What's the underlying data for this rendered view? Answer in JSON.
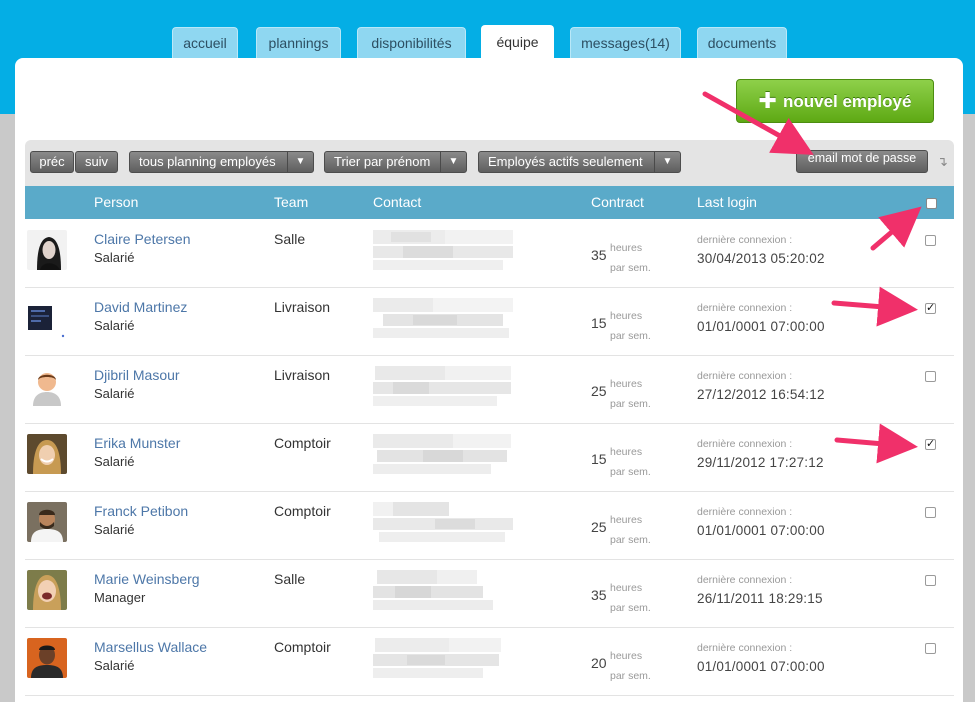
{
  "tabs": [
    {
      "label": "accueil",
      "active": false
    },
    {
      "label": "plannings",
      "active": false
    },
    {
      "label": "disponibilités",
      "active": false
    },
    {
      "label": "équipe",
      "active": true
    },
    {
      "label": "messages(14)",
      "active": false
    },
    {
      "label": "documents",
      "active": false
    }
  ],
  "new_employee_button": {
    "label": "nouvel employé",
    "icon": "plus-icon"
  },
  "toolbar": {
    "prev_label": "préc",
    "next_label": "suiv",
    "planning_select": "tous planning employés",
    "sort_select": "Trier par prénom",
    "filter_select": "Employés actifs seulement",
    "email_password_label": "email mot de passe",
    "sort_icon": "down-arrow-icon"
  },
  "table": {
    "headers": {
      "person": "Person",
      "team": "Team",
      "contact": "Contact",
      "contract": "Contract",
      "last_login": "Last login"
    },
    "hours_unit_1": "heures",
    "hours_unit_2": "par sem.",
    "last_login_label": "dernière connexion :",
    "rows": [
      {
        "name": "Claire Petersen",
        "role": "Salarié",
        "team": "Salle",
        "hours": "35",
        "last_login": "30/04/2013 05:20:02",
        "checked": false
      },
      {
        "name": "David Martinez",
        "role": "Salarié",
        "team": "Livraison",
        "hours": "15",
        "last_login": "01/01/0001 07:00:00",
        "checked": true
      },
      {
        "name": "Djibril Masour",
        "role": "Salarié",
        "team": "Livraison",
        "hours": "25",
        "last_login": "27/12/2012 16:54:12",
        "checked": false
      },
      {
        "name": "Erika Munster",
        "role": "Salarié",
        "team": "Comptoir",
        "hours": "15",
        "last_login": "29/11/2012 17:27:12",
        "checked": true
      },
      {
        "name": "Franck Petibon",
        "role": "Salarié",
        "team": "Comptoir",
        "hours": "25",
        "last_login": "01/01/0001 07:00:00",
        "checked": false
      },
      {
        "name": "Marie Weinsberg",
        "role": "Manager",
        "team": "Salle",
        "hours": "35",
        "last_login": "26/11/2011 18:29:15",
        "checked": false
      },
      {
        "name": "Marsellus Wallace",
        "role": "Salarié",
        "team": "Comptoir",
        "hours": "20",
        "last_login": "01/01/0001 07:00:00",
        "checked": false
      }
    ]
  },
  "colors": {
    "accent_blue": "#04aee5",
    "header_blue": "#5aaac9",
    "green_button": "#6dbb24",
    "annotation_arrow": "#f0306a",
    "link": "#4d77a8"
  }
}
